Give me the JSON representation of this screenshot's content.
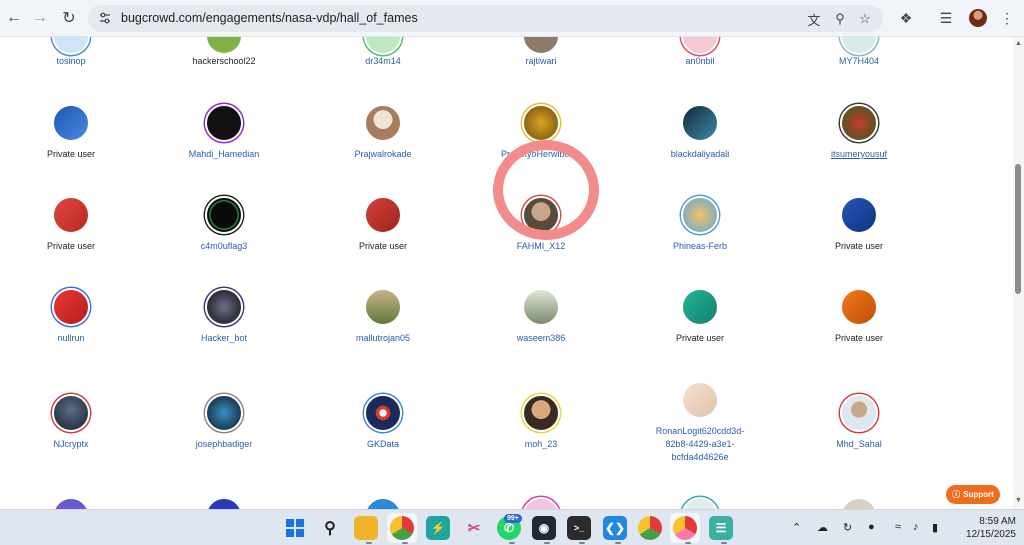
{
  "browser": {
    "url": "bugcrowd.com/engagements/nasa-vdp/hall_of_fames",
    "icons": [
      "back-icon",
      "forward-icon",
      "reload-icon",
      "site-settings-icon",
      "translate-icon",
      "zoom-icon",
      "bookmark-star-icon",
      "extensions-icon",
      "reading-list-icon",
      "profile-avatar",
      "more-menu-icon"
    ]
  },
  "hall_of_fame": {
    "row0": [
      {
        "name": "tosinop",
        "link": true
      },
      {
        "name": "hackerschool22",
        "link": false
      },
      {
        "name": "dr34m14",
        "link": true
      },
      {
        "name": "rajtiwari",
        "link": true
      },
      {
        "name": "an0nbil",
        "link": true
      },
      {
        "name": "MY7H404",
        "link": true
      }
    ],
    "row1": [
      {
        "name": "Private user",
        "link": false
      },
      {
        "name": "Mahdi_Hamedian",
        "link": true
      },
      {
        "name": "Prajwalrokade",
        "link": true
      },
      {
        "name": "PrasetyoHerwibowo",
        "link": true
      },
      {
        "name": "blackdaliyadali",
        "link": true
      },
      {
        "name": "itsumeryousuf",
        "link": true
      }
    ],
    "row2": [
      {
        "name": "Private user",
        "link": false
      },
      {
        "name": "c4m0uflag3",
        "link": true
      },
      {
        "name": "Private user",
        "link": false
      },
      {
        "name": "FAHMI_X12",
        "link": true
      },
      {
        "name": "Phineas-Ferb",
        "link": true
      },
      {
        "name": "Private user",
        "link": false
      }
    ],
    "row3": [
      {
        "name": "nullrun",
        "link": true
      },
      {
        "name": "Hacker_bot",
        "link": true
      },
      {
        "name": "mallutrojan05",
        "link": true
      },
      {
        "name": "waseem386",
        "link": true
      },
      {
        "name": "Private user",
        "link": false
      },
      {
        "name": "Private user",
        "link": false
      }
    ],
    "row4": [
      {
        "name": "NJcryptx",
        "link": true
      },
      {
        "name": "josephbadiger",
        "link": true
      },
      {
        "name": "GKData",
        "link": true
      },
      {
        "name": "moh_23",
        "link": true
      },
      {
        "name": "RonanLogit620cdd3d-82b8-4429-a3e1-bcfda4d4626e",
        "link": true
      },
      {
        "name": "Mhd_Sahal",
        "link": true
      }
    ],
    "wrapped": {
      "name_a": "RonanLogit620cdd3d-",
      "name_b": "82b8-4429-a3e1-",
      "name_c": "bcfda4d4626e"
    }
  },
  "support_button": {
    "label": "Support",
    "color": "#f26b1d"
  },
  "taskbar": {
    "badge": "99+",
    "time": "8:59 AM",
    "date": "12/15/2025"
  }
}
